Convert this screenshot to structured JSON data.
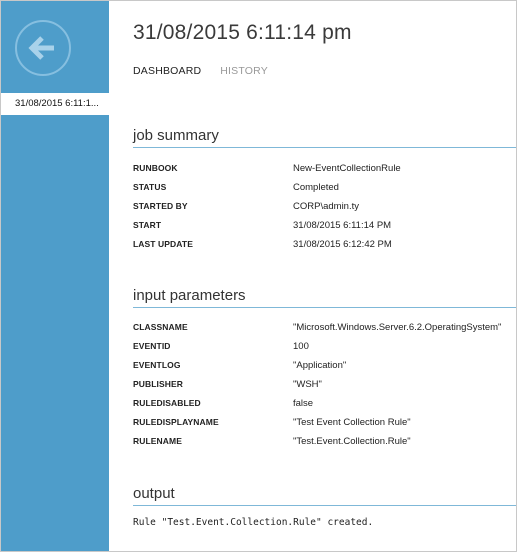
{
  "header": {
    "title": "31/08/2015 6:11:14 pm",
    "tabs": [
      {
        "label": "DASHBOARD",
        "active": true
      },
      {
        "label": "HISTORY",
        "active": false
      }
    ]
  },
  "sidebar": {
    "back_icon": "back-arrow-icon",
    "selected_item": "31/08/2015 6:11:1...",
    "color": "#4e9dca"
  },
  "job_summary": {
    "heading": "job summary",
    "rows": [
      {
        "key": "RUNBOOK",
        "value": "New-EventCollectionRule"
      },
      {
        "key": "STATUS",
        "value": "Completed"
      },
      {
        "key": "STARTED BY",
        "value": "CORP\\admin.ty"
      },
      {
        "key": "START",
        "value": "31/08/2015 6:11:14 PM"
      },
      {
        "key": "LAST UPDATE",
        "value": "31/08/2015 6:12:42 PM"
      }
    ]
  },
  "input_parameters": {
    "heading": "input parameters",
    "rows": [
      {
        "key": "CLASSNAME",
        "value": "\"Microsoft.Windows.Server.6.2.OperatingSystem\""
      },
      {
        "key": "EVENTID",
        "value": "100"
      },
      {
        "key": "EVENTLOG",
        "value": "\"Application\""
      },
      {
        "key": "PUBLISHER",
        "value": "\"WSH\""
      },
      {
        "key": "RULEDISABLED",
        "value": "false"
      },
      {
        "key": "RULEDISPLAYNAME",
        "value": "\"Test Event Collection Rule\""
      },
      {
        "key": "RULENAME",
        "value": "\"Test.Event.Collection.Rule\""
      }
    ]
  },
  "output": {
    "heading": "output",
    "text": "Rule \"Test.Event.Collection.Rule\" created."
  }
}
